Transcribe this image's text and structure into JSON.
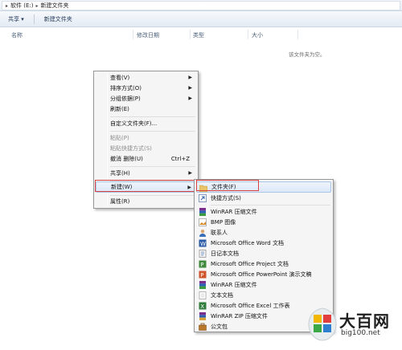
{
  "address": {
    "segments": [
      "软件 (E:)",
      "新建文件夹"
    ]
  },
  "toolbar": {
    "share_label": "共享 ▾",
    "new_folder_label": "新建文件夹"
  },
  "columns": {
    "name": "名称",
    "date": "修改日期",
    "type": "类型",
    "size": "大小"
  },
  "empty_note": "该文件夹为空。",
  "context_menu": {
    "items": [
      {
        "label": "查看(V)",
        "submenu": true
      },
      {
        "label": "排序方式(O)",
        "submenu": true
      },
      {
        "label": "分组依据(P)",
        "submenu": true
      },
      {
        "label": "刷新(E)"
      },
      {
        "label": "自定义文件夹(F)..."
      },
      {
        "label": "粘贴(P)",
        "disabled": true
      },
      {
        "label": "粘贴快捷方式(S)",
        "disabled": true
      },
      {
        "label": "撤消 删除(U)",
        "shortcut": "Ctrl+Z"
      },
      {
        "label": "共享(H)",
        "submenu": true
      },
      {
        "label": "新建(W)",
        "submenu": true,
        "highlighted": true
      },
      {
        "label": "属性(R)"
      }
    ]
  },
  "new_submenu": {
    "items": [
      {
        "label": "文件夹(F)",
        "icon": "folder-icon",
        "highlighted": true
      },
      {
        "label": "快捷方式(S)",
        "icon": "shortcut-icon"
      },
      {
        "label": "WinRAR 压缩文件",
        "icon": "winrar-icon"
      },
      {
        "label": "BMP 图像",
        "icon": "bmp-image-icon"
      },
      {
        "label": "联系人",
        "icon": "contact-icon"
      },
      {
        "label": "Microsoft Office Word 文档",
        "icon": "word-doc-icon"
      },
      {
        "label": "日记本文档",
        "icon": "journal-icon"
      },
      {
        "label": "Microsoft Office Project 文档",
        "icon": "project-doc-icon"
      },
      {
        "label": "Microsoft Office PowerPoint 演示文稿",
        "icon": "powerpoint-icon"
      },
      {
        "label": "WinRAR 压缩文件",
        "icon": "winrar-icon"
      },
      {
        "label": "文本文档",
        "icon": "text-doc-icon"
      },
      {
        "label": "Microsoft Office Excel 工作表",
        "icon": "excel-icon"
      },
      {
        "label": "WinRAR ZIP 压缩文件",
        "icon": "winrar-zip-icon"
      },
      {
        "label": "公文包",
        "icon": "briefcase-icon"
      }
    ]
  },
  "watermark": {
    "title": "大百网",
    "url": "big100.net"
  },
  "colors": {
    "highlight_border": "#d9423f",
    "menu_bg": "#f5f5f5",
    "toolbar_text": "#1e3555"
  }
}
